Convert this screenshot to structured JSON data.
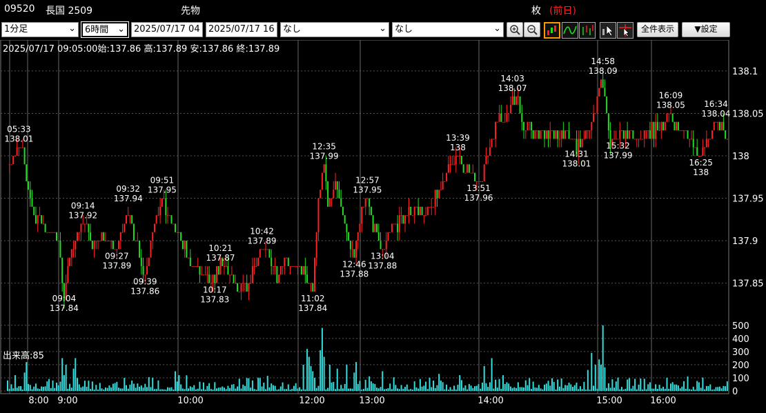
{
  "header": {
    "code": "09520",
    "name": "長国 2509",
    "category": "先物",
    "unit_label": "枚",
    "prev_label": "(前日)",
    "prev_color": "#ff2020"
  },
  "toolbar": {
    "interval": "1分足",
    "span": "6時間",
    "from_date": "2025/07/17 04",
    "to_date": "2025/07/17 16",
    "indicator1": "なし",
    "indicator2": "なし",
    "zoom_in_icon": "magnify-plus-icon",
    "zoom_out_icon": "magnify-minus-icon",
    "full_view_label": "全件表示",
    "settings_label": "▼設定"
  },
  "info_line": "2025/07/17 09:05:00始:137.86 高:137.89 安:137.86 終:137.89",
  "volume_label": "出来高:85",
  "colors": {
    "up": "#ff2020",
    "down": "#22dd22",
    "volume": "#33dddd",
    "grid": "#555555",
    "background": "#000000"
  },
  "chart_data": {
    "type": "candlestick",
    "price_axis": {
      "ticks": [
        137.85,
        137.9,
        137.95,
        138,
        138.05,
        138.1
      ],
      "labels": [
        "137.85",
        "137.9",
        "137.95",
        "138",
        "138.05",
        "138.1"
      ],
      "range": [
        137.805,
        138.13
      ]
    },
    "volume_axis": {
      "ticks": [
        0,
        100,
        200,
        300,
        400,
        500
      ],
      "range": [
        0,
        520
      ]
    },
    "time_labels": [
      "8:00",
      "9:00",
      "10:00",
      "12:00",
      "13:00",
      "14:00",
      "15:00",
      "16:00"
    ],
    "price_path": [
      [
        0,
        137.99
      ],
      [
        3,
        138.0
      ],
      [
        6,
        138.01
      ],
      [
        8,
        138.01
      ],
      [
        9,
        137.98
      ],
      [
        11,
        137.96
      ],
      [
        14,
        137.93
      ],
      [
        19,
        137.92
      ],
      [
        23,
        137.91
      ],
      [
        27,
        137.9
      ],
      [
        29,
        137.86
      ],
      [
        30,
        137.84
      ],
      [
        33,
        137.88
      ],
      [
        37,
        137.91
      ],
      [
        40,
        137.92
      ],
      [
        45,
        137.9
      ],
      [
        50,
        137.9
      ],
      [
        55,
        137.9
      ],
      [
        58,
        137.89
      ],
      [
        61,
        137.91
      ],
      [
        64,
        137.94
      ],
      [
        67,
        137.91
      ],
      [
        70,
        137.88
      ],
      [
        73,
        137.86
      ],
      [
        76,
        137.9
      ],
      [
        79,
        137.93
      ],
      [
        82,
        137.95
      ],
      [
        86,
        137.92
      ],
      [
        90,
        137.91
      ],
      [
        94,
        137.89
      ],
      [
        98,
        137.87
      ],
      [
        103,
        137.86
      ],
      [
        108,
        137.85
      ],
      [
        113,
        137.87
      ],
      [
        118,
        137.86
      ],
      [
        123,
        137.84
      ],
      [
        128,
        137.85
      ],
      [
        132,
        137.88
      ],
      [
        135,
        137.89
      ],
      [
        139,
        137.88
      ],
      [
        143,
        137.86
      ],
      [
        148,
        137.88
      ],
      [
        153,
        137.87
      ],
      [
        158,
        137.86
      ],
      [
        162,
        137.84
      ],
      [
        165,
        137.95
      ],
      [
        168,
        137.99
      ],
      [
        170,
        137.94
      ],
      [
        174,
        137.97
      ],
      [
        178,
        137.93
      ],
      [
        181,
        137.9
      ],
      [
        184,
        137.88
      ],
      [
        188,
        137.93
      ],
      [
        191,
        137.95
      ],
      [
        195,
        137.91
      ],
      [
        199,
        137.89
      ],
      [
        202,
        137.91
      ],
      [
        207,
        137.92
      ],
      [
        212,
        137.93
      ],
      [
        217,
        137.94
      ],
      [
        222,
        137.93
      ],
      [
        227,
        137.95
      ],
      [
        231,
        137.97
      ],
      [
        235,
        137.99
      ],
      [
        239,
        138.0
      ],
      [
        242,
        137.98
      ],
      [
        246,
        137.98
      ],
      [
        250,
        137.97
      ],
      [
        254,
        137.99
      ],
      [
        257,
        138.02
      ],
      [
        261,
        138.05
      ],
      [
        264,
        138.04
      ],
      [
        268,
        138.07
      ],
      [
        271,
        138.06
      ],
      [
        274,
        138.03
      ],
      [
        278,
        138.03
      ],
      [
        282,
        138.02
      ],
      [
        286,
        138.03
      ],
      [
        290,
        138.02
      ],
      [
        294,
        138.03
      ],
      [
        298,
        138.02
      ],
      [
        302,
        138.01
      ],
      [
        306,
        138.02
      ],
      [
        310,
        138.04
      ],
      [
        314,
        138.08
      ],
      [
        316,
        138.09
      ],
      [
        318,
        138.05
      ],
      [
        320,
        138.01
      ],
      [
        324,
        138.02
      ],
      [
        328,
        138.03
      ],
      [
        332,
        138.02
      ],
      [
        336,
        138.02
      ],
      [
        340,
        138.03
      ],
      [
        344,
        138.03
      ],
      [
        348,
        138.04
      ],
      [
        352,
        138.05
      ],
      [
        356,
        138.03
      ],
      [
        360,
        138.03
      ],
      [
        364,
        138.01
      ],
      [
        368,
        138.0
      ],
      [
        372,
        138.02
      ],
      [
        376,
        138.04
      ],
      [
        380,
        138.03
      ],
      [
        382,
        138.02
      ]
    ],
    "price_annotations": [
      {
        "time": "05:33",
        "value": "138.01",
        "pos": "above",
        "xi": 6,
        "v": 138.01
      },
      {
        "time": "09:04",
        "value": "137.84",
        "pos": "below",
        "xi": 30,
        "v": 137.84
      },
      {
        "time": "09:14",
        "value": "137.92",
        "pos": "above",
        "xi": 40,
        "v": 137.92
      },
      {
        "time": "09:27",
        "value": "137.89",
        "pos": "below",
        "xi": 58,
        "v": 137.89
      },
      {
        "time": "09:32",
        "value": "137.94",
        "pos": "above",
        "xi": 64,
        "v": 137.94
      },
      {
        "time": "09:39",
        "value": "137.86",
        "pos": "below",
        "xi": 73,
        "v": 137.86
      },
      {
        "time": "09:51",
        "value": "137.95",
        "pos": "above",
        "xi": 82,
        "v": 137.95
      },
      {
        "time": "10:17",
        "value": "137.83",
        "pos": "below",
        "xi": 110,
        "v": 137.85
      },
      {
        "time": "10:21",
        "value": "137.87",
        "pos": "above",
        "xi": 113,
        "v": 137.87
      },
      {
        "time": "10:42",
        "value": "137.89",
        "pos": "above",
        "xi": 135,
        "v": 137.89
      },
      {
        "time": "11:02",
        "value": "137.84",
        "pos": "below",
        "xi": 162,
        "v": 137.84
      },
      {
        "time": "12:35",
        "value": "137.99",
        "pos": "above",
        "xi": 168,
        "v": 137.99
      },
      {
        "time": "12:46",
        "value": "137.88",
        "pos": "below",
        "xi": 184,
        "v": 137.88
      },
      {
        "time": "12:57",
        "value": "137.95",
        "pos": "above",
        "xi": 191,
        "v": 137.95
      },
      {
        "time": "13:04",
        "value": "137.88",
        "pos": "below",
        "xi": 199,
        "v": 137.89
      },
      {
        "time": "13:39",
        "value": "138",
        "pos": "above",
        "xi": 239,
        "v": 138.0
      },
      {
        "time": "13:51",
        "value": "137.96",
        "pos": "below",
        "xi": 250,
        "v": 137.97
      },
      {
        "time": "14:03",
        "value": "138.07",
        "pos": "above",
        "xi": 268,
        "v": 138.07
      },
      {
        "time": "14:31",
        "value": "138.01",
        "pos": "below",
        "xi": 302,
        "v": 138.01
      },
      {
        "time": "14:58",
        "value": "138.09",
        "pos": "above",
        "xi": 316,
        "v": 138.09
      },
      {
        "time": "15:32",
        "value": "137.99",
        "pos": "below",
        "xi": 324,
        "v": 138.02
      },
      {
        "time": "16:09",
        "value": "138.05",
        "pos": "above",
        "xi": 352,
        "v": 138.05
      },
      {
        "time": "16:25",
        "value": "138",
        "pos": "below",
        "xi": 368,
        "v": 138.0
      },
      {
        "time": "16:34",
        "value": "138.04",
        "pos": "above",
        "xi": 376,
        "v": 138.04
      }
    ],
    "volume_spikes": [
      [
        0,
        80
      ],
      [
        4,
        120
      ],
      [
        9,
        140
      ],
      [
        10,
        220
      ],
      [
        24,
        80
      ],
      [
        29,
        250
      ],
      [
        30,
        120
      ],
      [
        31,
        200
      ],
      [
        35,
        170
      ],
      [
        36,
        250
      ],
      [
        62,
        100
      ],
      [
        89,
        150
      ],
      [
        91,
        120
      ],
      [
        130,
        80
      ],
      [
        157,
        200
      ],
      [
        159,
        320
      ],
      [
        160,
        260
      ],
      [
        161,
        190
      ],
      [
        162,
        150
      ],
      [
        163,
        100
      ],
      [
        166,
        310
      ],
      [
        167,
        480
      ],
      [
        168,
        260
      ],
      [
        171,
        200
      ],
      [
        175,
        170
      ],
      [
        180,
        200
      ],
      [
        184,
        140
      ],
      [
        185,
        220
      ],
      [
        199,
        150
      ],
      [
        229,
        130
      ],
      [
        240,
        120
      ],
      [
        253,
        190
      ],
      [
        257,
        250
      ],
      [
        263,
        120
      ],
      [
        308,
        160
      ],
      [
        310,
        290
      ],
      [
        312,
        200
      ],
      [
        314,
        240
      ],
      [
        315,
        200
      ],
      [
        316,
        500
      ],
      [
        317,
        180
      ],
      [
        350,
        100
      ],
      [
        361,
        110
      ]
    ]
  }
}
